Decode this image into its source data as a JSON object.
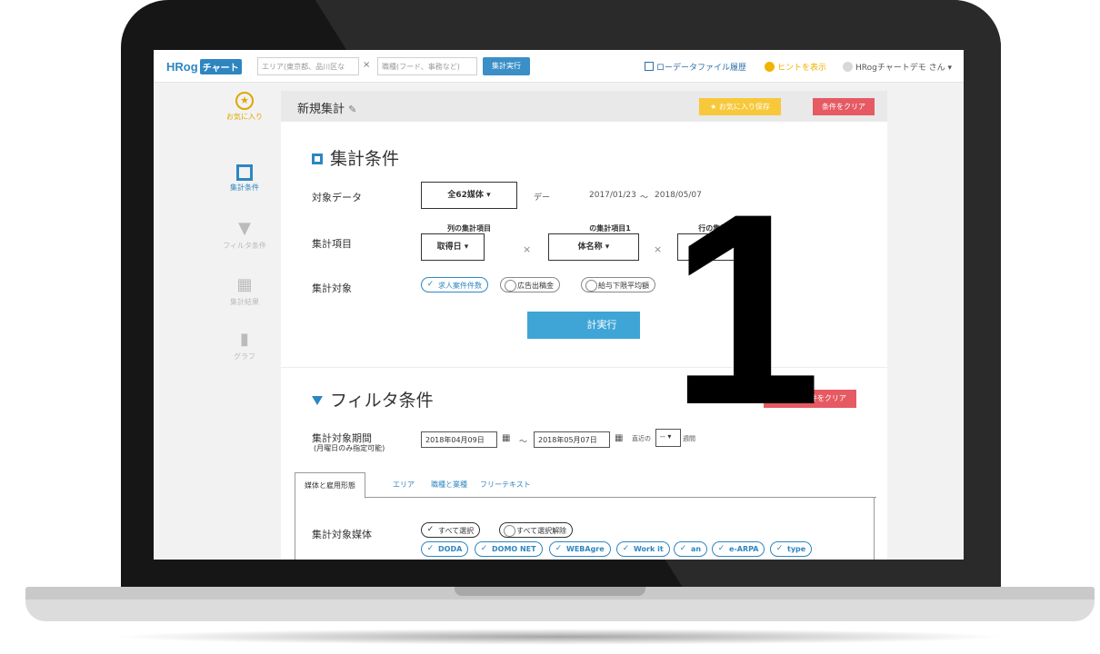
{
  "header": {
    "logo_text": "HRog",
    "logo_chip": "チャート",
    "area_placeholder": "エリア(東京都、品川区な",
    "separator": "×",
    "job_placeholder": "職種(フード、事務など)",
    "run_button": "集計実行",
    "history_link": "ローデータファイル履歴",
    "hint_link": "ヒントを表示",
    "user_menu": "HRogチャートデモ さん ▾"
  },
  "sidebar": {
    "items": [
      {
        "label": "お気に入り",
        "icon": "star-icon"
      },
      {
        "label": "集計条件",
        "icon": "form-icon"
      },
      {
        "label": "フィルタ条件",
        "icon": "funnel-icon"
      },
      {
        "label": "集計結果",
        "icon": "grid-icon"
      },
      {
        "label": "グラフ",
        "icon": "bar-chart-icon"
      }
    ]
  },
  "titlebar": {
    "title": "新規集計",
    "fav_button": "★ お気に入り保存",
    "clear_button": "条件をクリア"
  },
  "conditions": {
    "heading": "集計条件",
    "target_data_label": "対象データ",
    "media_select": "全62媒体 ▾",
    "data_label_prefix": "デー",
    "date_from": "2017/01/23",
    "date_sep": "〜",
    "date_to": "2018/05/07",
    "items_label": "集計項目",
    "col_item_label": "列の集計項目",
    "col_item_value": "取得日 ▾",
    "row1_label": "の集計項目1",
    "row1_value": "体名称 ▾",
    "row2_label": "行の集計項目2",
    "row2_value": "-- ▾",
    "times": "×",
    "target_label": "集計対象",
    "target_options": [
      "求人案件件数",
      "広告出稿金",
      "給与下限平均額"
    ],
    "run_button": "集計実行",
    "run_visible_text": "計実行"
  },
  "filter": {
    "heading": "フィルタ条件",
    "clear_button": "フィルタ条件をクリア",
    "period_label": "集計対象期間",
    "period_note": "(月曜日のみ指定可能)",
    "from": "2018年04月09日",
    "tilde": "〜",
    "to": "2018年05月07日",
    "recent_prefix": "直近の",
    "recent_value": "-- ▾",
    "recent_suffix": "週間",
    "tabs": [
      "媒体と雇用形態",
      "エリア",
      "職種と業種",
      "フリーテキスト"
    ],
    "media_label": "集計対象媒体",
    "select_all": "すべて選択",
    "deselect_all": "すべて選択解除",
    "media": [
      "DODA",
      "DOMO NET",
      "WEBAgre",
      "Work it",
      "an",
      "e-ARPA",
      "type"
    ]
  },
  "overlay": {
    "number": "1"
  }
}
